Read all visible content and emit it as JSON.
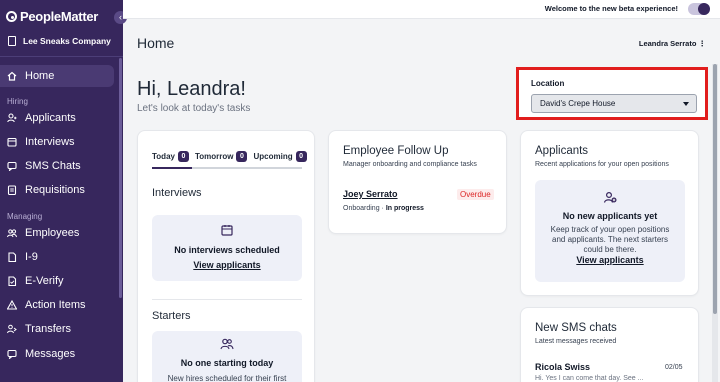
{
  "app": {
    "logo": "PeopleMatter",
    "company": "Lee Sneaks Company"
  },
  "sidebar": {
    "items": [
      {
        "label": "Home",
        "icon": "home-icon",
        "active": true
      },
      {
        "label": "Applicants",
        "icon": "applicants-icon"
      },
      {
        "label": "Interviews",
        "icon": "interviews-icon"
      },
      {
        "label": "SMS Chats",
        "icon": "chat-icon"
      },
      {
        "label": "Requisitions",
        "icon": "requisitions-icon"
      },
      {
        "label": "Employees",
        "icon": "employees-icon"
      },
      {
        "label": "I-9",
        "icon": "i9-icon"
      },
      {
        "label": "E-Verify",
        "icon": "everify-icon"
      },
      {
        "label": "Action Items",
        "icon": "warning-icon"
      },
      {
        "label": "Transfers",
        "icon": "transfers-icon"
      },
      {
        "label": "Messages",
        "icon": "messages-icon"
      }
    ],
    "sections": {
      "hiring": "Hiring",
      "managing": "Managing"
    }
  },
  "topbar": {
    "beta_text": "Welcome to the new beta experience!",
    "beta_enabled": true
  },
  "header": {
    "title": "Home",
    "user": "Leandra Serrato"
  },
  "greeting": {
    "title": "Hi, Leandra!",
    "subtitle": "Let's look at today's tasks"
  },
  "location": {
    "label": "Location",
    "selected": "David's Crepe House"
  },
  "tasks": {
    "tabs": [
      {
        "label": "Today",
        "count": "0"
      },
      {
        "label": "Tomorrow",
        "count": "0"
      },
      {
        "label": "Upcoming",
        "count": "0"
      }
    ],
    "interviews": {
      "title": "Interviews",
      "empty": "No interviews scheduled",
      "link": "View applicants"
    },
    "starters": {
      "title": "Starters",
      "empty": "No one starting today",
      "sub": "New hires scheduled for their first"
    }
  },
  "followup": {
    "title": "Employee Follow Up",
    "subtitle": "Manager onboarding and compliance tasks",
    "person": "Joey Serrato",
    "status": "Overdue",
    "detail_prefix": "Onboarding",
    "detail_sep": " · ",
    "detail_value": "In progress"
  },
  "applicants": {
    "title": "Applicants",
    "subtitle": "Recent applications for your open positions",
    "empty": "No new applicants yet",
    "desc1": "Keep track of your open positions",
    "desc2": "and applicants. The next starters",
    "desc3": "could be there.",
    "link": "View applicants"
  },
  "sms": {
    "title": "New SMS chats",
    "subtitle": "Latest messages received",
    "name": "Ricola Swiss",
    "date": "02/05",
    "preview": "Hi. Yes I can come that day. See ..."
  },
  "colors": {
    "sidebar": "#37275d",
    "accent": "#37275d",
    "highlight": "#e11d1d",
    "overdue": "#dc2626"
  }
}
